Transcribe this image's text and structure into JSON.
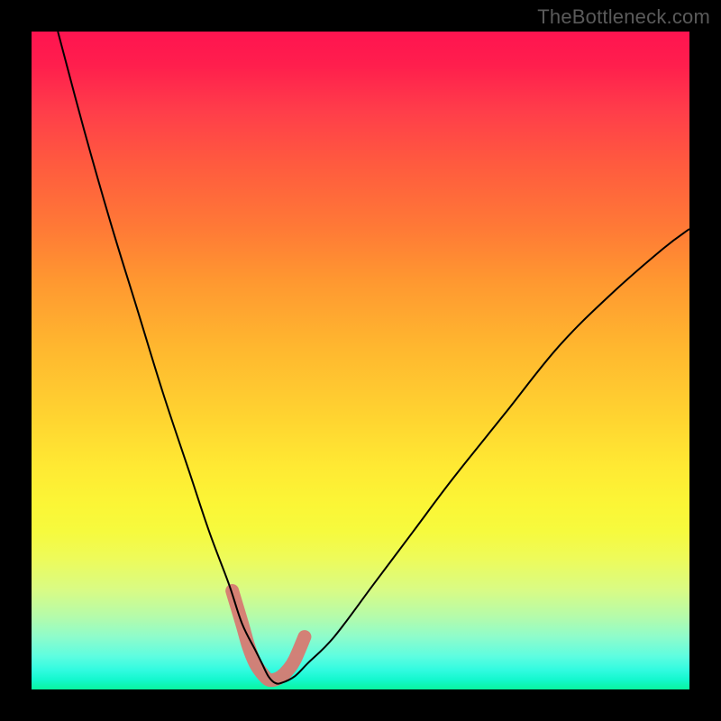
{
  "watermark": "TheBottleneck.com",
  "colors": {
    "frame_bg": "#000000",
    "watermark": "#5a5a5a",
    "curve": "#000000",
    "marker": "#d77a72"
  },
  "chart_data": {
    "type": "line",
    "title": "",
    "xlabel": "",
    "ylabel": "",
    "xlim": [
      0,
      100
    ],
    "ylim": [
      0,
      100
    ],
    "grid": false,
    "series": [
      {
        "name": "bottleneck-curve",
        "x": [
          4,
          8,
          12,
          16,
          20,
          24,
          27,
          30,
          32,
          34,
          35,
          36,
          37,
          38,
          40,
          42,
          46,
          52,
          58,
          64,
          72,
          80,
          88,
          96,
          100
        ],
        "y": [
          100,
          85,
          71,
          58,
          45,
          33,
          24,
          16,
          10,
          6,
          4,
          2,
          1,
          1,
          2,
          4,
          8,
          16,
          24,
          32,
          42,
          52,
          60,
          67,
          70
        ]
      }
    ],
    "markers": {
      "name": "highlight-band",
      "x": [
        30.5,
        32,
        33,
        34,
        35,
        36,
        37,
        38,
        39,
        40,
        41.5
      ],
      "y": [
        15,
        10,
        6.5,
        4,
        2.5,
        1.5,
        1.5,
        2,
        3,
        4.5,
        8
      ]
    },
    "background_gradient": {
      "type": "vertical",
      "stops": [
        {
          "pos": 0.0,
          "color": "#ff1450"
        },
        {
          "pos": 0.2,
          "color": "#ff5a3f"
        },
        {
          "pos": 0.48,
          "color": "#ffb72f"
        },
        {
          "pos": 0.72,
          "color": "#f6fa3e"
        },
        {
          "pos": 0.89,
          "color": "#b4fbab"
        },
        {
          "pos": 1.0,
          "color": "#0af59f"
        }
      ]
    }
  }
}
